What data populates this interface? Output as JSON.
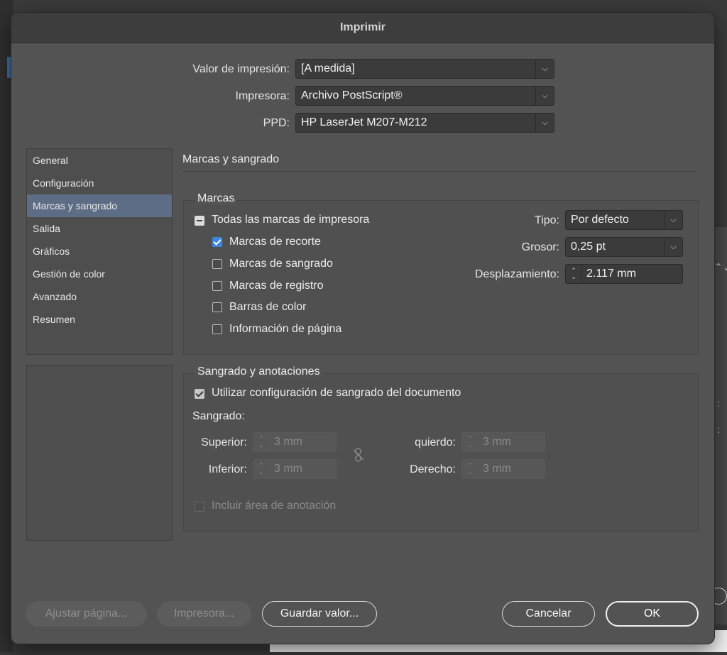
{
  "dialog": {
    "title": "Imprimir"
  },
  "top_fields": {
    "preset": {
      "label": "Valor de impresión:",
      "value": "[A medida]"
    },
    "printer": {
      "label": "Impresora:",
      "value": "Archivo PostScript®"
    },
    "ppd": {
      "label": "PPD:",
      "value": "HP LaserJet M207-M212"
    }
  },
  "sidebar": {
    "items": [
      {
        "label": "General"
      },
      {
        "label": "Configuración"
      },
      {
        "label": "Marcas y sangrado"
      },
      {
        "label": "Salida"
      },
      {
        "label": "Gráficos"
      },
      {
        "label": "Gestión de color"
      },
      {
        "label": "Avanzado"
      },
      {
        "label": "Resumen"
      }
    ],
    "active_index": 2
  },
  "panel": {
    "title": "Marcas y sangrado",
    "marks": {
      "group_label": "Marcas",
      "all_marks": {
        "label": "Todas las marcas de impresora",
        "state": "mixed"
      },
      "options": [
        {
          "label": "Marcas de recorte",
          "checked": true
        },
        {
          "label": "Marcas de sangrado",
          "checked": false
        },
        {
          "label": "Marcas de registro",
          "checked": false
        },
        {
          "label": "Barras de color",
          "checked": false
        },
        {
          "label": "Información de página",
          "checked": false
        }
      ],
      "type": {
        "label": "Tipo:",
        "value": "Por defecto"
      },
      "weight": {
        "label": "Grosor:",
        "value": "0,25 pt"
      },
      "offset": {
        "label": "Desplazamiento:",
        "value": "2.117 mm"
      }
    },
    "bleed": {
      "group_label": "Sangrado y anotaciones",
      "use_doc": {
        "label": "Utilizar configuración de sangrado del documento",
        "checked": true
      },
      "bleed_label": "Sangrado:",
      "top": {
        "label": "Superior:",
        "value": "3 mm"
      },
      "bottom": {
        "label": "Inferior:",
        "value": "3 mm"
      },
      "left": {
        "label": "quierdo:",
        "value": "3 mm"
      },
      "right": {
        "label": "Derecho:",
        "value": "3 mm"
      },
      "slug": {
        "label": "Incluir área de anotación",
        "checked": false
      }
    }
  },
  "buttons": {
    "page_setup": "Ajustar página...",
    "printer": "Impresora...",
    "save_preset": "Guardar valor...",
    "cancel": "Cancelar",
    "ok": "OK"
  },
  "icons": {
    "dropdown": "chevron-down-icon",
    "spinner": "stepper-arrows-icon",
    "link": "broken-link-icon"
  },
  "colors": {
    "dialog_bg": "#535353",
    "sidebar_active": "#5d6d85",
    "checkbox_accent": "#3a86e0"
  }
}
